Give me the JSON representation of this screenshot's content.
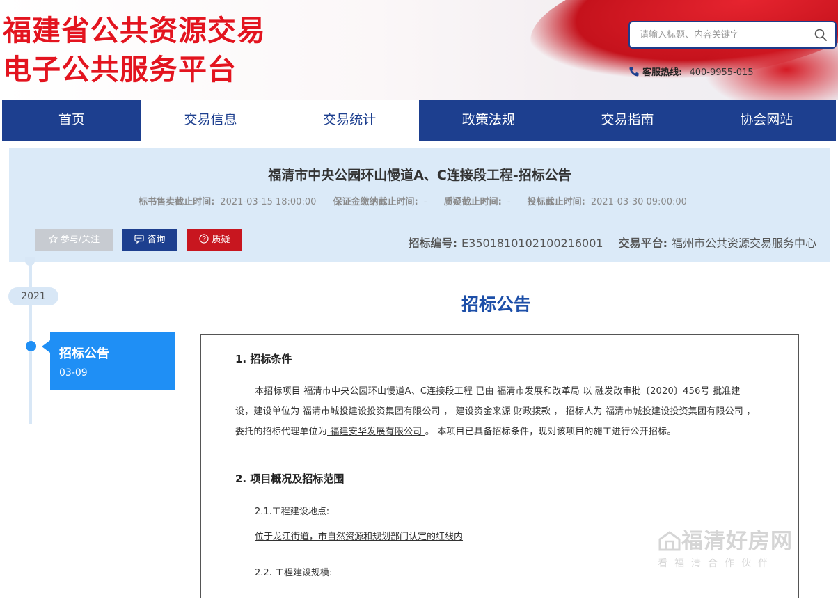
{
  "header": {
    "logo_line1": "福建省公共资源交易",
    "logo_line2": "电子公共服务平台",
    "search_placeholder": "请输入标题、内容关键字",
    "hotline_label": "客服热线:",
    "hotline_number": "400-9955-015"
  },
  "nav": {
    "items": [
      {
        "label": "首页"
      },
      {
        "label": "交易信息"
      },
      {
        "label": "交易统计"
      },
      {
        "label": "政策法规"
      },
      {
        "label": "交易指南"
      },
      {
        "label": "协会网站"
      }
    ]
  },
  "notice": {
    "title": "福清市中央公园环山慢道A、C连接段工程-招标公告",
    "meta": [
      {
        "key": "标书售卖截止时间:",
        "value": "2021-03-15 18:00:00"
      },
      {
        "key": "保证金缴纳截止时间:",
        "value": "-"
      },
      {
        "key": "质疑截止时间:",
        "value": "-"
      },
      {
        "key": "投标截止时间:",
        "value": "2021-03-30 09:00:00"
      }
    ],
    "buttons": {
      "follow": "参与/关注",
      "consult": "咨询",
      "query": "质疑"
    },
    "bid_no_label": "招标编号:",
    "bid_no": "E3501810102100216001",
    "platform_label": "交易平台:",
    "platform": "福州市公共资源交易服务中心"
  },
  "timeline": {
    "year": "2021",
    "card_title": "招标公告",
    "card_date": "03-09"
  },
  "document": {
    "heading": "招标公告",
    "section1_title": "1. 招标条件",
    "p1": {
      "t1": "本招标项目",
      "project": " 福清市中央公园环山慢道A、C连接段工程 ",
      "t2": "已由",
      "approver": " 福清市发展和改革局 ",
      "t3": "以",
      "approval_no": " 融发改审批〔2020〕456号 ",
      "t4": "批准建设，建设单位为",
      "builder": " 福清市城投建设投资集团有限公司 ",
      "t5": "， 建设资金来源",
      "fund": " 财政拨款 ",
      "t6": "， 招标人为",
      "tenderer": " 福清市城投建设投资集团有限公司 ",
      "t7": "， 委托的招标代理单位为",
      "agent": " 福建安华发展有限公司 ",
      "t8": "。 本项目已具备招标条件，现对该项目的施工进行公开招标。"
    },
    "section2_title": "2. 项目概况及招标范围",
    "s21_label": "2.1.工程建设地点:",
    "s21_value": "位于龙江街道，市自然资源和规划部门认定的红线内",
    "s22_label": "2.2. 工程建设规模:"
  },
  "watermark": {
    "main": "福清好房网",
    "sub": "看福清合作伙伴"
  }
}
